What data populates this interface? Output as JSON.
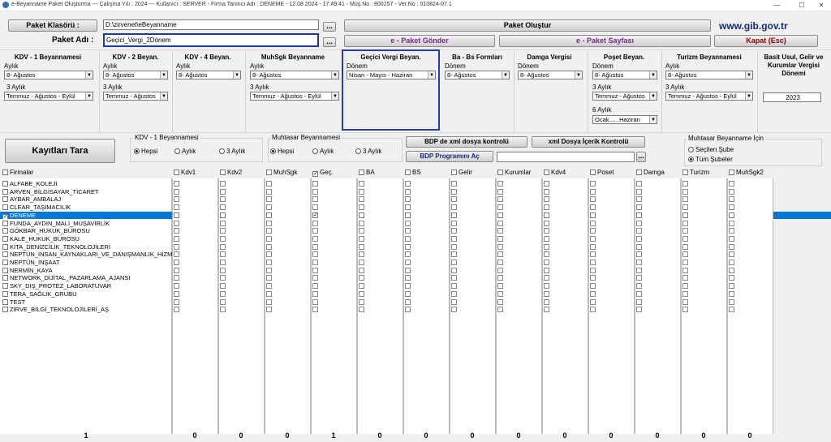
{
  "window": {
    "title": "e-Beyanname Paket Oluşturma  ---  Çalışma Yılı : 2024  ---  Kullanıcı : SERVER - Firma Tanıtıcı Adı : DENEME - 12.08.2024 - 17:49:41 - Müş.No : 800257 - Ver.No : 010824-07.1"
  },
  "top": {
    "paket_klasoru_label": "Paket Klasörü :",
    "paket_klasoru_value": "D:\\zirvenet\\eBeyanname",
    "paket_adi_label": "Paket Adı :",
    "paket_adi_value": "Geçici_Vergi_2Dönem",
    "browse": "...",
    "paket_olustur": "Paket Oluştur",
    "paket_gonder": "e - Paket Gönder",
    "paket_sayfasi": "e - Paket Sayfası",
    "gib_link": "www.gib.gov.tr",
    "kapat": "Kapat (Esc)"
  },
  "panels": {
    "kdv1": {
      "title": "KDV - 1 Beyannamesi",
      "l1": "Aylık",
      "v1": "8- Ağustos",
      "l2": "3 Aylık",
      "v2": "Temmuz - Ağustos - Eylül"
    },
    "kdv2": {
      "title": "KDV - 2 Beyan.",
      "l1": "Aylık",
      "v1": "8- Ağustos",
      "l2": "3 Aylık",
      "v2": "Temmuz - Ağustos"
    },
    "kdv4": {
      "title": "KDV - 4 Beyan.",
      "l1": "Aylık",
      "v1": "8- Ağustos"
    },
    "muhsgk": {
      "title": "MuhSgk Beyanname",
      "l1": "Aylık",
      "v1": "8- Ağustos",
      "l2": "3 Aylık",
      "v2": "Temmuz - Ağustos - Eylül"
    },
    "gecici": {
      "title": "Geçici Vergi Beyan.",
      "l1": "Dönem",
      "v1": "Nisan - Mayıs - Haziran"
    },
    "babs": {
      "title": "Ba - Bs Formları",
      "l1": "Dönem",
      "v1": "8- Ağustos"
    },
    "damga": {
      "title": "Damga Vergisi",
      "l1": "Dönem",
      "v1": "8- Ağustos"
    },
    "poset": {
      "title": "Poşet Beyan.",
      "l1": "Dönem",
      "v1": "8- Ağustos",
      "l2": "3 Aylık",
      "v2": "Temmuz - Ağustos",
      "l3": "6 Aylık",
      "v3": "Ocak......Haziran"
    },
    "turizm": {
      "title": "Turizm Beyannamesi",
      "l1": "Aylık",
      "v1": "8- Ağustos",
      "l2": "3 Aylık",
      "v2": "Temmuz - Ağustos - Eylül"
    },
    "basit": {
      "title": "Basit Usul, Gelir ve Kurumlar Vergisi Dönemi",
      "v1": "2023"
    }
  },
  "mid": {
    "kayitlari_tara": "Kayıtları Tara",
    "kdv_group": "KDV - 1 Beyannamesi",
    "muh_group": "Muhtasar Beyannamesi",
    "opt_hepsi": "Hepsi",
    "opt_aylik": "Aylık",
    "opt_3aylik": "3 Aylık",
    "bdp_xml": "BDP de xml dosya kontrolü",
    "xml_icerik": "xml Dosya İçerik Kontrolü",
    "bdp_ac": "BDP Programını Aç",
    "muh_icin": "Muhtasar Beyanname İçin",
    "secilen_sube": "Seçilen Şube",
    "tum_subeler": "Tüm Şubeler"
  },
  "grid": {
    "firma_header": "Firmalar",
    "columns": [
      "Kdv1",
      "Kdv2",
      "MuhSgk",
      "Geç.",
      "BA",
      "BS",
      "Gelir",
      "Kurumlar",
      "Kdv4",
      "Poset",
      "Damga",
      "Turizm",
      "MuhSgk2"
    ],
    "firms": [
      "ALFABE_KOLEJİ",
      "ARVEN_BİLGİSAYAR_TİCARET",
      "AYBAR_AMBALAJ",
      "CLEAR_TAŞIMACILIK",
      "DENEME",
      "FUNDA_AYDIN_MALİ_MÜŞAVİRLİK",
      "GÖKBAR_HUKUK_BÜROSU",
      "KALE_HUKUK_BÜROSU",
      "KİTA_DENİZCİLİK_TEKNOLOJİLERİ",
      "NEPTÜN_İNSAN_KAYNAKLARI_VE_DANIŞMANLIK_HİZM",
      "NEPTÜN_İNŞAAT",
      "NERMİN_KAYA",
      "NETWORK_DİJİTAL_PAZARLAMA_AJANSI",
      "SKY_DIŞ_PROTEZ_LABORATUVAR",
      "TERA_SAĞLIK_GRUBU",
      "TEST",
      "ZİRVE_BİLGİ_TEKNOLOJİLERİ_AŞ"
    ],
    "selected_index": 4,
    "totals": [
      "1",
      "0",
      "0",
      "0",
      "1",
      "0",
      "0",
      "0",
      "0",
      "0",
      "0",
      "0",
      "0",
      "0"
    ]
  }
}
